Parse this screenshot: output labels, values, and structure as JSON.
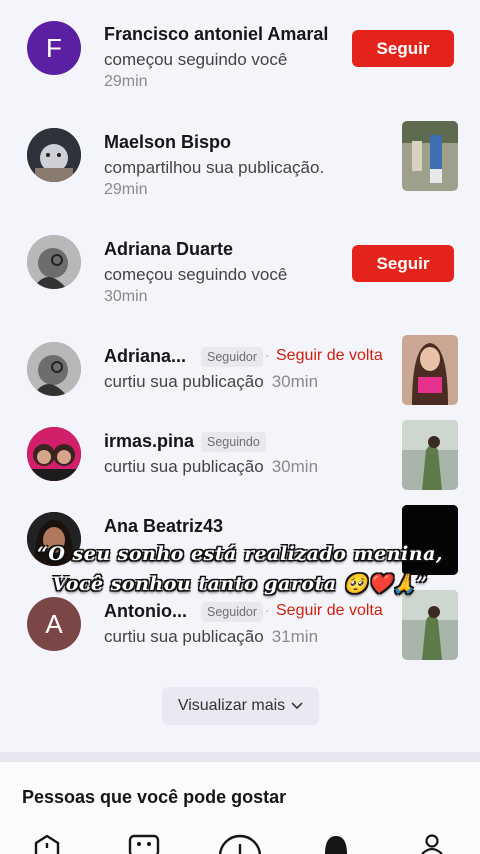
{
  "notifications": [
    {
      "name": "Francisco antoniel Amaral",
      "action": "começou seguindo você",
      "time": "29min",
      "avatar_letter": "F",
      "avatar_color": "#5b1fa3",
      "button": "Seguir"
    },
    {
      "name": "Maelson Bispo",
      "action": "compartilhou sua publicação.",
      "time": "29min"
    },
    {
      "name": "Adriana Duarte",
      "action": "começou seguindo você",
      "time": "30min",
      "button": "Seguir"
    },
    {
      "name": "Adriana...",
      "badge": "Seguidor",
      "follow_back": "Seguir de volta",
      "action": "curtiu sua publicação",
      "time": "30min"
    },
    {
      "name": "irmas.pina",
      "badge": "Seguindo",
      "action": "curtiu sua publicação",
      "time": "30min"
    },
    {
      "name": "Ana Beatriz43"
    },
    {
      "name": "Antonio...",
      "badge": "Seguidor",
      "follow_back": "Seguir de volta",
      "action": "curtiu sua publicação",
      "time": "31min",
      "avatar_letter": "A",
      "avatar_color": "#7a4646"
    }
  ],
  "caption": {
    "line1": "“O seu sonho está realizado menina,",
    "line2": "Você sonhou tanto garota 🥺❤️🙏”"
  },
  "load_more": {
    "label": "Visualizar mais",
    "icon": "chevron-down-icon"
  },
  "suggestions": {
    "title": "Pessoas que você pode gostar"
  },
  "tabbar": {
    "icons": [
      "home-icon",
      "friends-icon",
      "create-icon",
      "inbox-icon",
      "profile-icon"
    ]
  },
  "colors": {
    "accent_red": "#e4241a",
    "follow_back_red": "#d0200c",
    "background": "#f4f5fb"
  }
}
